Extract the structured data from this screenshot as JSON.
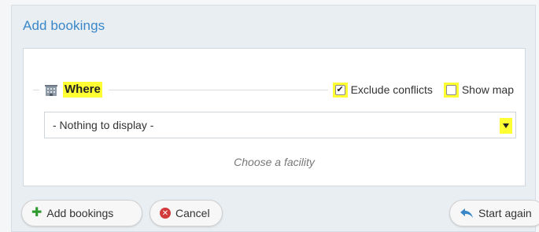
{
  "dialog": {
    "title": "Add bookings"
  },
  "where": {
    "label": "Where",
    "icon": "building-icon",
    "exclude_conflicts": {
      "label": "Exclude conflicts",
      "checked": true
    },
    "show_map": {
      "label": "Show map",
      "checked": false
    },
    "facility_select": {
      "value": "- Nothing to display -"
    },
    "hint": "Choose a facility"
  },
  "buttons": {
    "add": "Add bookings",
    "cancel": "Cancel",
    "start_again": "Start again"
  },
  "colors": {
    "accent": "#3a87c8",
    "highlight": "#ffff33",
    "add_icon": "#2f9a2f",
    "cancel_icon": "#d13b3b"
  }
}
